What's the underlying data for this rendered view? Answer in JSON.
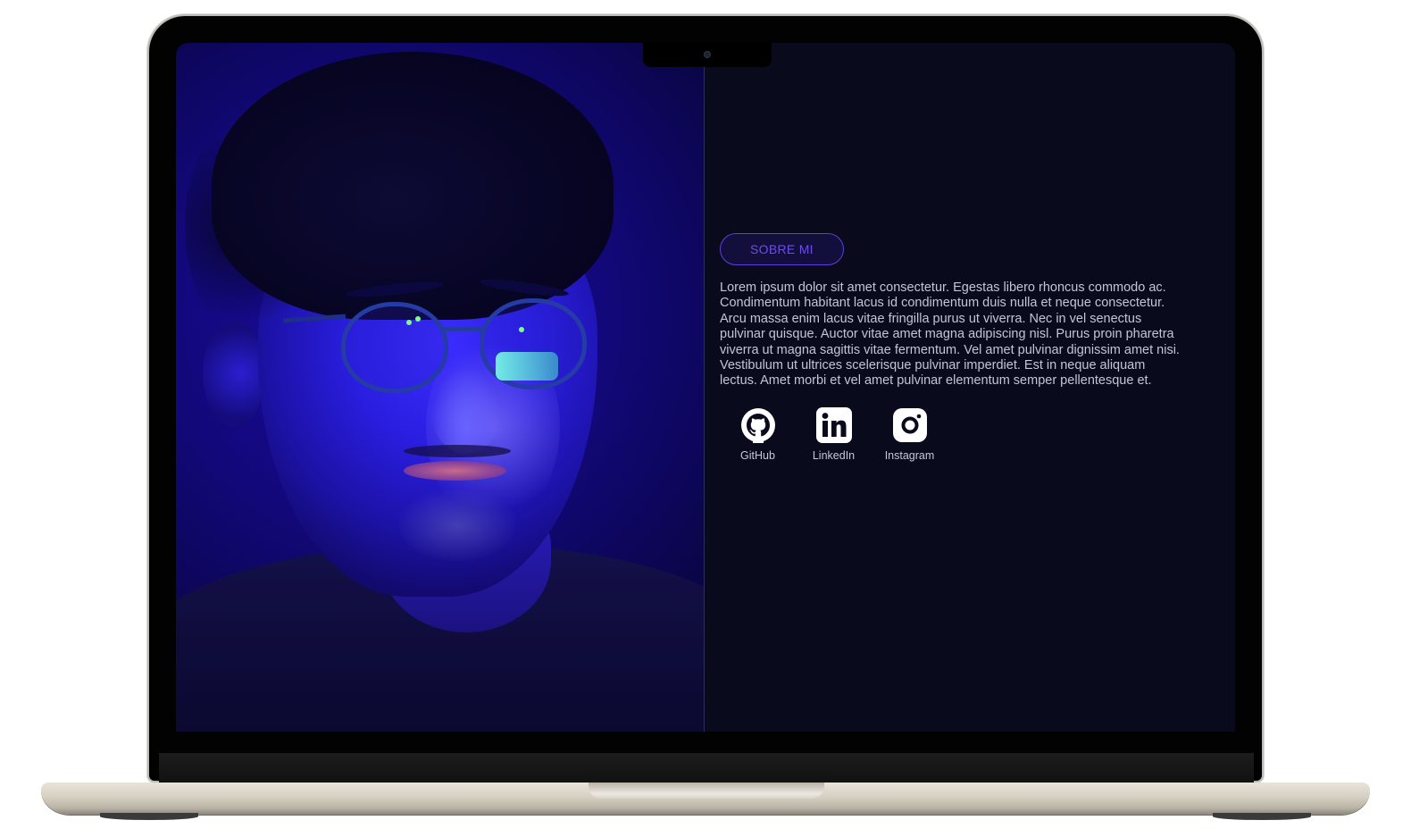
{
  "about": {
    "badge_label": "SOBRE MI",
    "bio": "Lorem ipsum dolor sit amet consectetur. Egestas libero rhoncus commodo ac. Condimentum habitant lacus id condimentum duis nulla et neque consectetur. Arcu massa enim lacus vitae fringilla purus ut viverra. Nec in vel senectus pulvinar quisque. Auctor vitae amet magna adipiscing nisl. Purus proin pharetra viverra ut magna sagittis vitae fermentum. Vel amet pulvinar dignissim amet nisi. Vestibulum ut ultrices scelerisque pulvinar imperdiet. Est in neque aliquam lectus. Amet morbi et vel amet pulvinar elementum semper pellentesque et."
  },
  "socials": [
    {
      "label": "GitHub",
      "icon": "github-icon"
    },
    {
      "label": "LinkedIn",
      "icon": "linkedin-icon"
    },
    {
      "label": "Instagram",
      "icon": "instagram-icon"
    }
  ],
  "colors": {
    "background": "#090a1c",
    "accent": "#6b4cf0",
    "text": "#c3c5d8"
  }
}
